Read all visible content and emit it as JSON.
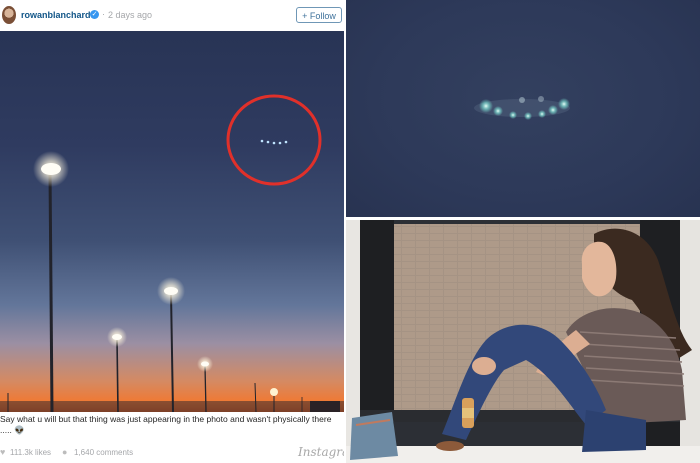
{
  "post": {
    "username": "rowanblanchard",
    "verified_icon": "verified-badge-icon",
    "separator": "·",
    "timestamp": "2 days ago",
    "follow_label": "+ Follow",
    "caption": "Say what u will but that thing was just appearing in the photo and wasn't physically there ..... 👽",
    "likes": "111.3k likes",
    "comments": "1,640 comments",
    "brand": "Instagram",
    "icons": {
      "likes": "heart-icon",
      "comments": "comment-bubble-icon"
    }
  },
  "colors": {
    "username": "#125688",
    "follow_border": "#6f97b6",
    "highlight_circle": "#e0302a",
    "night_sky": "#2d3959",
    "sunset": "#ee7a36"
  }
}
